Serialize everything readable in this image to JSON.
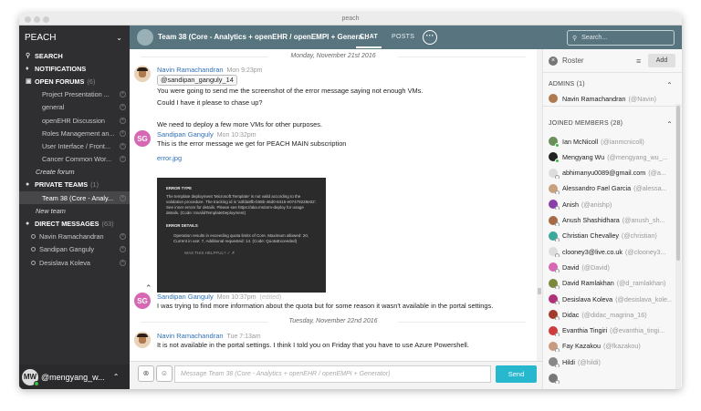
{
  "window": {
    "title": "peach"
  },
  "sidebar": {
    "team_name": "PEACH",
    "search": "SEARCH",
    "notifications": "NOTIFICATIONS",
    "open_forums": {
      "label": "OPEN FORUMS",
      "count": "(6)"
    },
    "forums": [
      "Project Presentation ...",
      "general",
      "openEHR Discussion",
      "Roles Management an...",
      "User Interface / Front...",
      "Cancer Common Wor..."
    ],
    "create_forum": "Create forum",
    "private_teams": {
      "label": "PRIVATE TEAMS",
      "count": "(1)"
    },
    "teams": [
      "Team 38 (Core - Analy..."
    ],
    "new_team": "New team",
    "direct_messages": {
      "label": "DIRECT MESSAGES",
      "count": "(63)"
    },
    "dms": [
      "Navin Ramachandran",
      "Sandipan Ganguly",
      "Desislava Koleva"
    ],
    "user": {
      "initials": "MW",
      "name": "@mengyang_w..."
    }
  },
  "topbar": {
    "channel_title": "Team 38 (Core - Analytics + openEHR / openEMPI + Genera...",
    "tab_chat": "CHAT",
    "tab_posts": "POSTS",
    "search_placeholder": "Search...",
    "accent": "#58757f"
  },
  "chat": {
    "date1": "Monday, November 21st 2016",
    "date2": "Tuesday, November 22nd 2016",
    "posts": [
      {
        "author": "Navin Ramachandran",
        "time": "Mon 9:23pm",
        "mention": "@sandipan_ganguly_14",
        "lines": [
          "You were going to send me the screenshot of the error message saying not enough VMs.",
          "Could I have it please to chase up?",
          "",
          "We need to deploy a few more VMs for other purposes."
        ]
      },
      {
        "author": "Sandipan Ganguly",
        "initials": "SG",
        "time": "Mon 10:32pm",
        "lines": [
          "This is the error message we get for PEACH MAIN subscription"
        ],
        "attachment": "error.jpg"
      },
      {
        "author": "Sandipan Ganguly",
        "initials": "SG",
        "time": "Mon 10:37pm",
        "edited": "(edited)",
        "lines": [
          "I was trying to find more information about the quota but for some reason it wasn't available in the portal settings."
        ]
      },
      {
        "author": "Navin Ramachandran",
        "time": "Tue 7:13am",
        "lines": [
          "It is not available in the portal settings. I think I told you on Friday that you have to use Azure Powershell."
        ]
      }
    ],
    "screenshot": {
      "h1": "ERROR TYPE",
      "p1": "The template deployment 'Microsoft.Template' is not valid according to the validation procedure. The tracking id is 'a3fda8fb-b08b-46d0-8415-e07479228e02'. See inner errors for details. Please see https://aka.ms/arm-deploy for usage details. (Code: InvalidTemplateDeployment)",
      "h2": "ERROR DETAILS",
      "p2": "Operation results in exceeding quota limits of Core. Maximum allowed: 20, Current in use: 7, Additional requested: 14. (Code: QuotaExceeded)",
      "footer": "WAS THIS HELPFUL?"
    }
  },
  "compose": {
    "placeholder": "Message Team 38 (Core - Analytics + openEHR / openEMPI + Generator)",
    "send": "Send",
    "send_color": "#27b7ce"
  },
  "roster": {
    "title": "Roster",
    "add": "Add",
    "admins_header": "ADMINS (1)",
    "admins": [
      {
        "name": "Navin Ramachandran",
        "user": "(@Navin)"
      }
    ],
    "members_header": "JOINED MEMBERS (28)",
    "members": [
      {
        "name": "Ian McNicoll",
        "user": "(@ianmcnicoll)",
        "color": "#6b8f5a",
        "online": true
      },
      {
        "name": "Mengyang Wu",
        "user": "(@mengyang_wu_...",
        "color": "#222222",
        "online": true
      },
      {
        "name": "abhimanyu0089@gmail.com",
        "user": "(@a...",
        "color": "#dddddd",
        "online": false
      },
      {
        "name": "Alessandro Fael Garcia",
        "user": "(@alessa...",
        "color": "#c7a27c",
        "online": false
      },
      {
        "name": "Anish",
        "user": "(@anishp)",
        "color": "#8b3fa8",
        "online": false
      },
      {
        "name": "Anush Shashidhara",
        "user": "(@anush_sh...",
        "color": "#a66a45",
        "online": false
      },
      {
        "name": "Christian Chevalley",
        "user": "(@christian)",
        "color": "#3aa79d",
        "online": false
      },
      {
        "name": "clooney3@live.co.uk",
        "user": "(@clooney3...",
        "color": "#dddddd",
        "online": false
      },
      {
        "name": "David",
        "user": "(@David)",
        "color": "#d867b3",
        "online": false
      },
      {
        "name": "David Ramlakhan",
        "user": "(@d_ramlakhan)",
        "color": "#7a8a3a",
        "online": false
      },
      {
        "name": "Desislava Koleva",
        "user": "(@desislava_kole...",
        "color": "#b0307a",
        "online": false
      },
      {
        "name": "Didac",
        "user": "(@didac_magrina_16)",
        "color": "#a33a2a",
        "online": false
      },
      {
        "name": "Evanthia Tingiri",
        "user": "(@evanthia_tingi...",
        "color": "#cf3a3a",
        "online": false
      },
      {
        "name": "Fay Kazakou",
        "user": "(@fkazakou)",
        "color": "#c89a80",
        "online": false
      },
      {
        "name": "Hildi",
        "user": "(@hildi)",
        "color": "#888888",
        "online": false
      },
      {
        "name": "",
        "user": "",
        "color": "#777777",
        "online": false
      }
    ]
  }
}
